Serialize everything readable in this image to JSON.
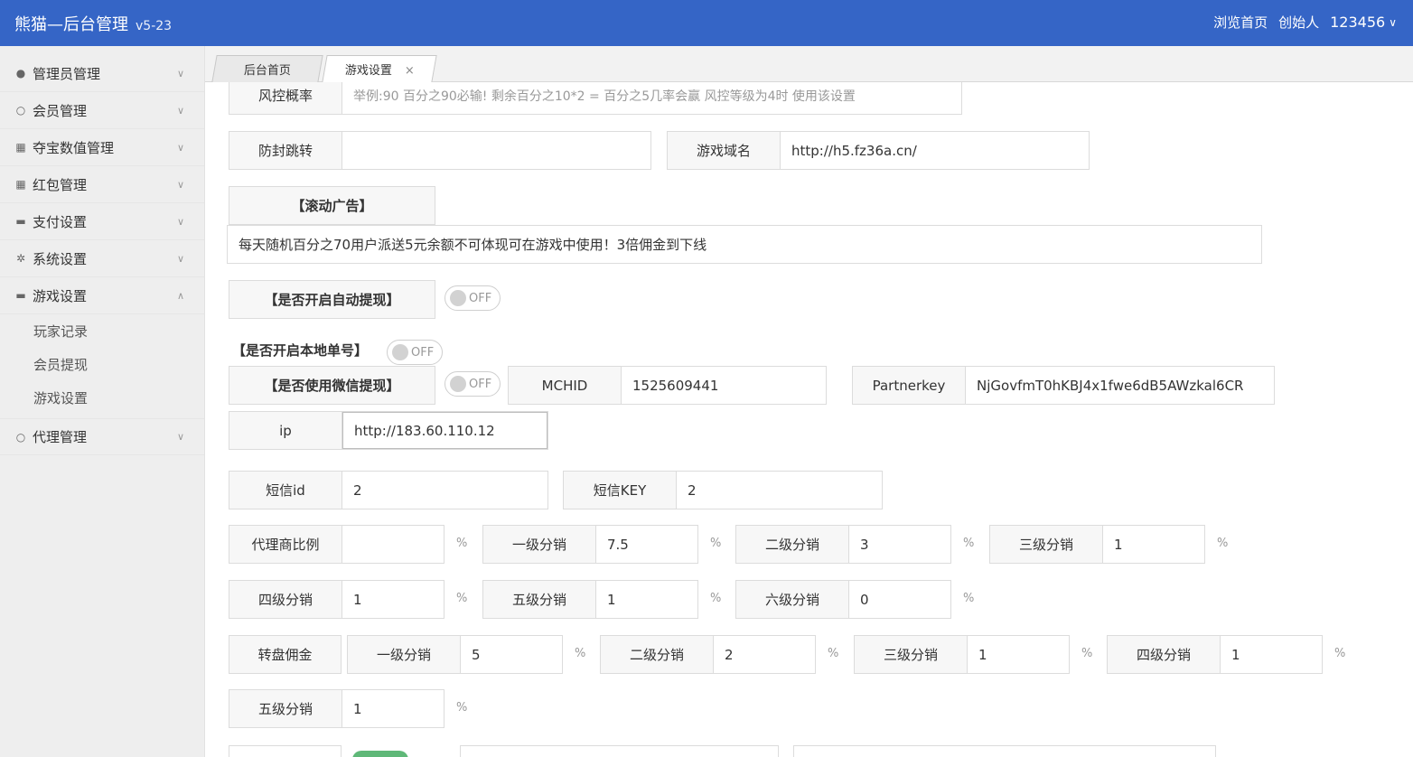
{
  "header": {
    "brand": "熊猫—后台管理",
    "version": "v5-23",
    "nav_home": "浏览首页",
    "role": "创始人",
    "username": "123456"
  },
  "sidebar": {
    "items": [
      {
        "label": "管理员管理",
        "icon": "user-icon"
      },
      {
        "label": "会员管理",
        "icon": "user-outline-icon"
      },
      {
        "label": "夺宝数值管理",
        "icon": "grid-icon"
      },
      {
        "label": "红包管理",
        "icon": "grid-icon"
      },
      {
        "label": "支付设置",
        "icon": "card-icon"
      },
      {
        "label": "系统设置",
        "icon": "gear-icon"
      },
      {
        "label": "游戏设置",
        "icon": "card-icon"
      }
    ],
    "sub_items": [
      "玩家记录",
      "会员提现",
      "游戏设置"
    ],
    "last_item": {
      "label": "代理管理",
      "icon": "user-outline-icon"
    }
  },
  "tabs": [
    {
      "label": "后台首页"
    },
    {
      "label": "游戏设置",
      "close": "×"
    }
  ],
  "form": {
    "risk_label": "风控概率",
    "risk_placeholder": "举例:90 百分之90必输! 剩余百分之10*2 = 百分之5几率会赢 风控等级为4时 使用该设置",
    "anti_block_label": "防封跳转",
    "anti_block_value": "",
    "game_domain_label": "游戏域名",
    "game_domain_value": "http://h5.fz36a.cn/",
    "scroll_ad_label": "【滚动广告】",
    "scroll_ad_value": "每天随机百分之70用户派送5元余额不可体现可在游戏中使用！3倍佣金到下线",
    "auto_withdraw_label": "【是否开启自动提现】",
    "auto_withdraw_toggle": "OFF",
    "local_order_label": "【是否开启本地单号】",
    "local_order_toggle": "OFF",
    "wechat_withdraw_label": "【是否使用微信提现】",
    "wechat_withdraw_toggle": "OFF",
    "mchid_label": "MCHID",
    "mchid_value": "1525609441",
    "partnerkey_label": "Partnerkey",
    "partnerkey_value": "NjGovfmT0hKBJ4x1fwe6dB5AWzkal6CR",
    "ip_label": "ip",
    "ip_value": "http://183.60.110.12",
    "sms_id_label": "短信id",
    "sms_id_value": "2",
    "sms_key_label": "短信KEY",
    "sms_key_value": "2",
    "agent_ratio_label": "代理商比例",
    "agent_ratio_value": "",
    "percent": "%",
    "level1_label": "一级分销",
    "level1_value": "7.5",
    "level2_label": "二级分销",
    "level2_value": "3",
    "level3_label": "三级分销",
    "level3_value": "1",
    "level4_label": "四级分销",
    "level4_value": "1",
    "level5_label": "五级分销",
    "level5_value": "1",
    "level6_label": "六级分销",
    "level6_value": "0",
    "wheel_label": "转盘佣金",
    "wheel_l1_label": "一级分销",
    "wheel_l1_value": "5",
    "wheel_l2_label": "二级分销",
    "wheel_l2_value": "2",
    "wheel_l3_label": "三级分销",
    "wheel_l3_value": "1",
    "wheel_l4_label": "四级分销",
    "wheel_l4_value": "1",
    "wheel_l5_label": "五级分销",
    "wheel_l5_value": "1"
  }
}
